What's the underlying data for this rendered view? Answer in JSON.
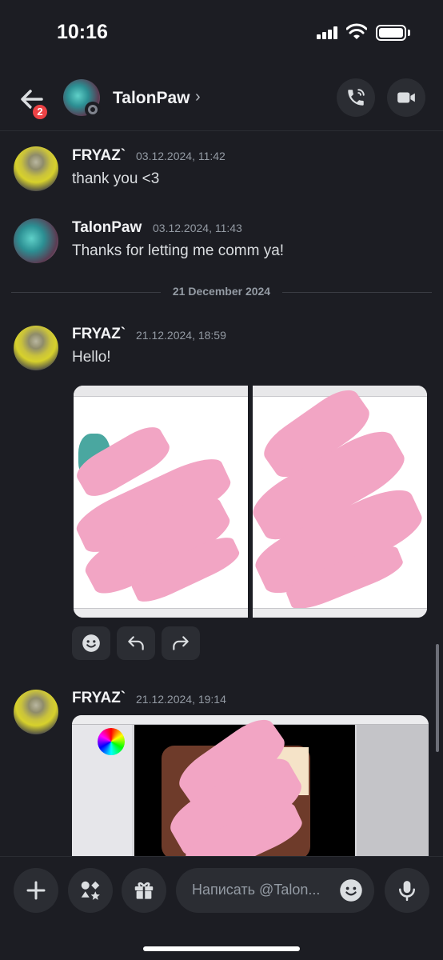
{
  "status": {
    "time": "10:16"
  },
  "header": {
    "back_badge": "2",
    "name": "TalonPaw",
    "chevron": "›"
  },
  "messages": [
    {
      "author": "FRYAZ`",
      "time": "03.12.2024, 11:42",
      "text": "thank you <3"
    },
    {
      "author": "TalonPaw",
      "time": "03.12.2024, 11:43",
      "text": "Thanks for letting me comm ya!"
    },
    {
      "author": "FRYAZ`",
      "time": "21.12.2024, 18:59",
      "text": "Hello!"
    },
    {
      "author": "FRYAZ`",
      "time": "21.12.2024, 19:14",
      "text": ""
    }
  ],
  "divider": {
    "label": "21 December 2024"
  },
  "composer": {
    "placeholder": "Написать @Talon..."
  },
  "icons": {
    "back": "arrow-left-icon",
    "call": "phone-icon",
    "video": "video-camera-icon",
    "add": "plus-icon",
    "apps": "apps-icon",
    "gift": "gift-icon",
    "emoji": "emoji-icon",
    "mic": "microphone-icon",
    "reply": "reply-icon",
    "forward": "forward-icon"
  },
  "colors": {
    "background": "#1c1d23",
    "surface": "#2b2d33",
    "badge": "#ed4245",
    "redaction": "#f2a5c4"
  }
}
